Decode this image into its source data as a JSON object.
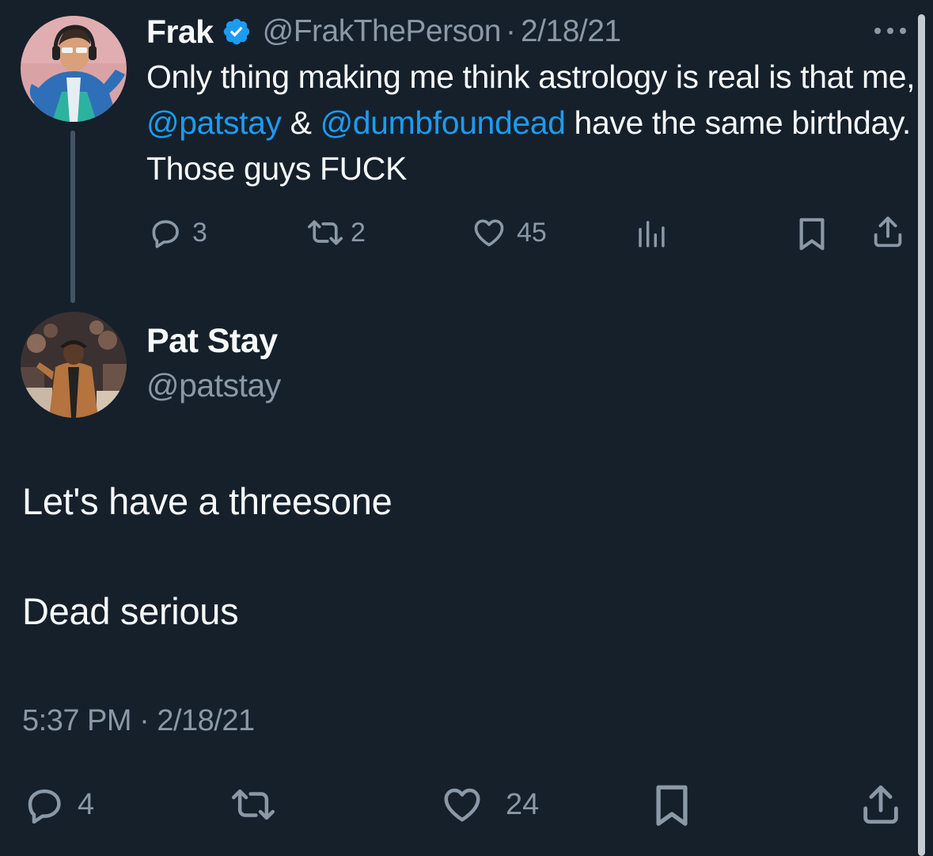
{
  "colors": {
    "background": "#15202b",
    "text": "#f7f9f9",
    "secondary_text": "#8b98a5",
    "link": "#1d9bf0",
    "verified": "#1d9bf0",
    "thread_line": "#425364"
  },
  "parent_tweet": {
    "display_name": "Frak",
    "verified_icon": "verified-badge-icon",
    "handle": "@FrakThePerson",
    "separator": "·",
    "date": "2/18/21",
    "more_icon": "more-options-icon",
    "text_part1": "Only thing making me think astrology is real is that me, ",
    "mention1": "@patstay",
    "text_part2": " & ",
    "mention2": "@dumbfoundead",
    "text_part3": " have the same birthday. Those guys FUCK",
    "actions": {
      "reply_count": "3",
      "retweet_count": "2",
      "like_count": "45",
      "reply_icon": "reply-icon",
      "retweet_icon": "retweet-icon",
      "like_icon": "heart-icon",
      "views_icon": "views-bar-chart-icon",
      "bookmark_icon": "bookmark-icon",
      "share_icon": "share-icon"
    }
  },
  "main_tweet": {
    "display_name": "Pat Stay",
    "handle": "@patstay",
    "line1": "Let's have a threesone",
    "line2": "Dead serious",
    "time": "5:37 PM",
    "separator": "·",
    "date": "2/18/21",
    "actions": {
      "reply_count": "4",
      "like_count": "24",
      "reply_icon": "reply-icon",
      "retweet_icon": "retweet-icon",
      "like_icon": "heart-icon",
      "bookmark_icon": "bookmark-icon",
      "share_icon": "share-icon"
    }
  }
}
